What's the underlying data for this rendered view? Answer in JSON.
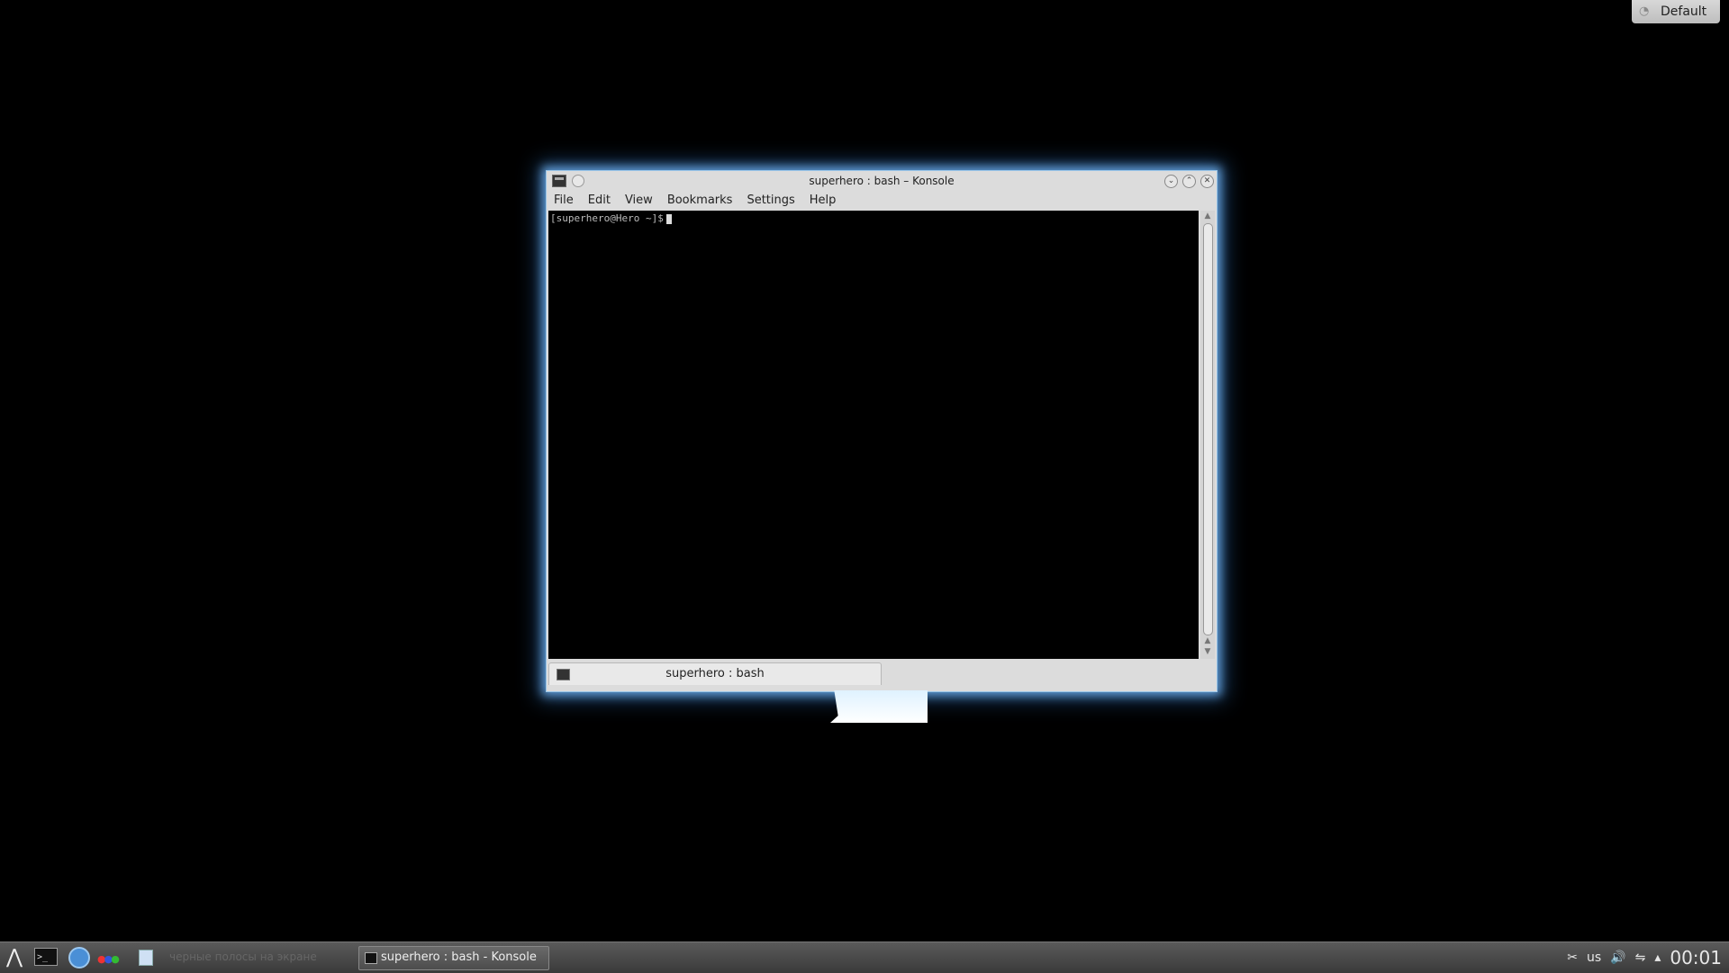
{
  "activity": {
    "label": "Default",
    "icon": "activity-icon"
  },
  "window": {
    "title": "superhero : bash – Konsole",
    "menu": [
      "File",
      "Edit",
      "View",
      "Bookmarks",
      "Settings",
      "Help"
    ],
    "prompt": "[superhero@Hero ~]$",
    "tab_label": "superhero : bash"
  },
  "taskbar": {
    "dim_task": "черные полосы на экране",
    "task_label": "superhero : bash - Konsole",
    "tray": {
      "keyboard": "us",
      "clock": "00:01"
    }
  },
  "colors": {
    "glow": "#78beff",
    "window_bg": "#dcdcdc",
    "desktop": "#000000"
  }
}
